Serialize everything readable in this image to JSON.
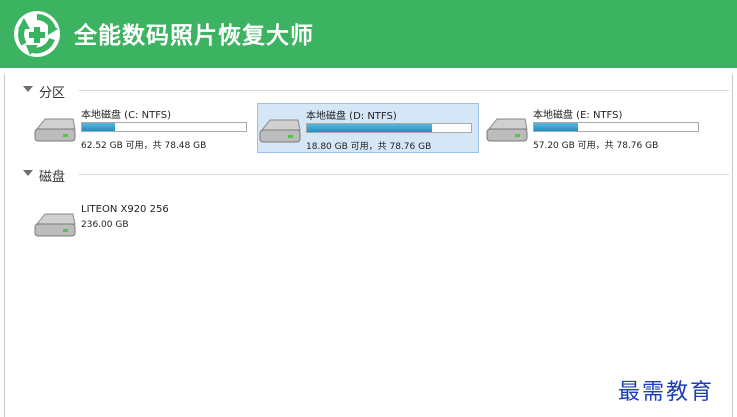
{
  "app": {
    "title": "全能数码照片恢复大师",
    "logo_icon": "recycle-plus-icon"
  },
  "colors": {
    "header_bg": "#3bb360",
    "selected_bg": "#d5e6f7",
    "bar_fill": "#2390c1",
    "watermark": "#1c40b5"
  },
  "sections": [
    {
      "label": "分区",
      "drives": [
        {
          "name": "本地磁盘 (C: NTFS)",
          "info": "62.52 GB 可用，共 78.48 GB",
          "used_fraction": 0.2,
          "selected": false
        },
        {
          "name": "本地磁盘 (D: NTFS)",
          "info": "18.80 GB 可用，共 78.76 GB",
          "used_fraction": 0.76,
          "selected": true
        },
        {
          "name": "本地磁盘 (E: NTFS)",
          "info": "57.20 GB 可用，共 78.76 GB",
          "used_fraction": 0.27,
          "selected": false
        }
      ]
    },
    {
      "label": "磁盘",
      "drives": [
        {
          "name": "LITEON X920 256",
          "info": "236.00 GB"
        }
      ]
    }
  ],
  "watermark": "最需教育"
}
